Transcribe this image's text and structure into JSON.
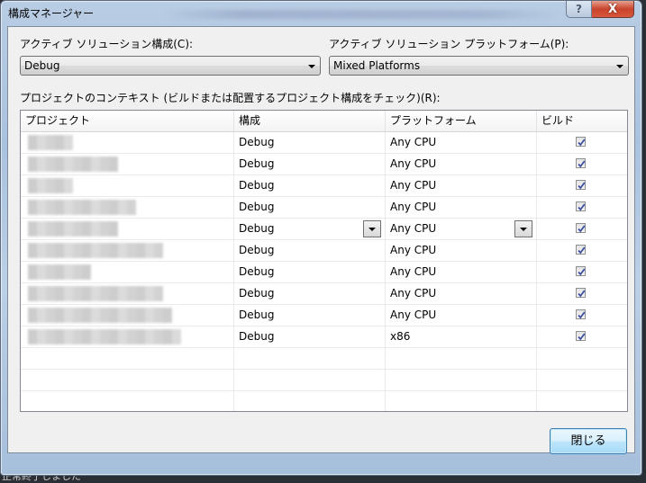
{
  "window": {
    "title": "構成マネージャー",
    "help_icon": "question-icon",
    "close_icon": "close-x-icon",
    "help_glyph": "?",
    "close_glyph": "X"
  },
  "solution_config": {
    "label": "アクティブ ソリューション構成(C):",
    "value": "Debug"
  },
  "solution_platform": {
    "label": "アクティブ ソリューション プラットフォーム(P):",
    "value": "Mixed Platforms"
  },
  "project_context": {
    "label": "プロジェクトのコンテキスト (ビルドまたは配置するプロジェクト構成をチェック)(R):",
    "columns": [
      "プロジェクト",
      "構成",
      "プラットフォーム",
      "ビルド"
    ],
    "rows": [
      {
        "project": "[blurred]",
        "config": "Debug",
        "platform": "Any CPU",
        "build": true
      },
      {
        "project": "[blurred]",
        "config": "Debug",
        "platform": "Any CPU",
        "build": true
      },
      {
        "project": "[blurred]",
        "config": "Debug",
        "platform": "Any CPU",
        "build": true
      },
      {
        "project": "[blurred]",
        "config": "Debug",
        "platform": "Any CPU",
        "build": true
      },
      {
        "project": "[blurred]",
        "config": "Debug",
        "platform": "Any CPU",
        "build": true,
        "active": true
      },
      {
        "project": "[blurred]",
        "config": "Debug",
        "platform": "Any CPU",
        "build": true
      },
      {
        "project": "[blurred]",
        "config": "Debug",
        "platform": "Any CPU",
        "build": true
      },
      {
        "project": "[blurred]",
        "config": "Debug",
        "platform": "Any CPU",
        "build": true
      },
      {
        "project": "[blurred]",
        "config": "Debug",
        "platform": "Any CPU",
        "build": true
      },
      {
        "project": "[blurred]",
        "config": "Debug",
        "platform": "x86",
        "build": true
      }
    ]
  },
  "buttons": {
    "close_label": "閉じる"
  },
  "background_text": "正常終了しました"
}
